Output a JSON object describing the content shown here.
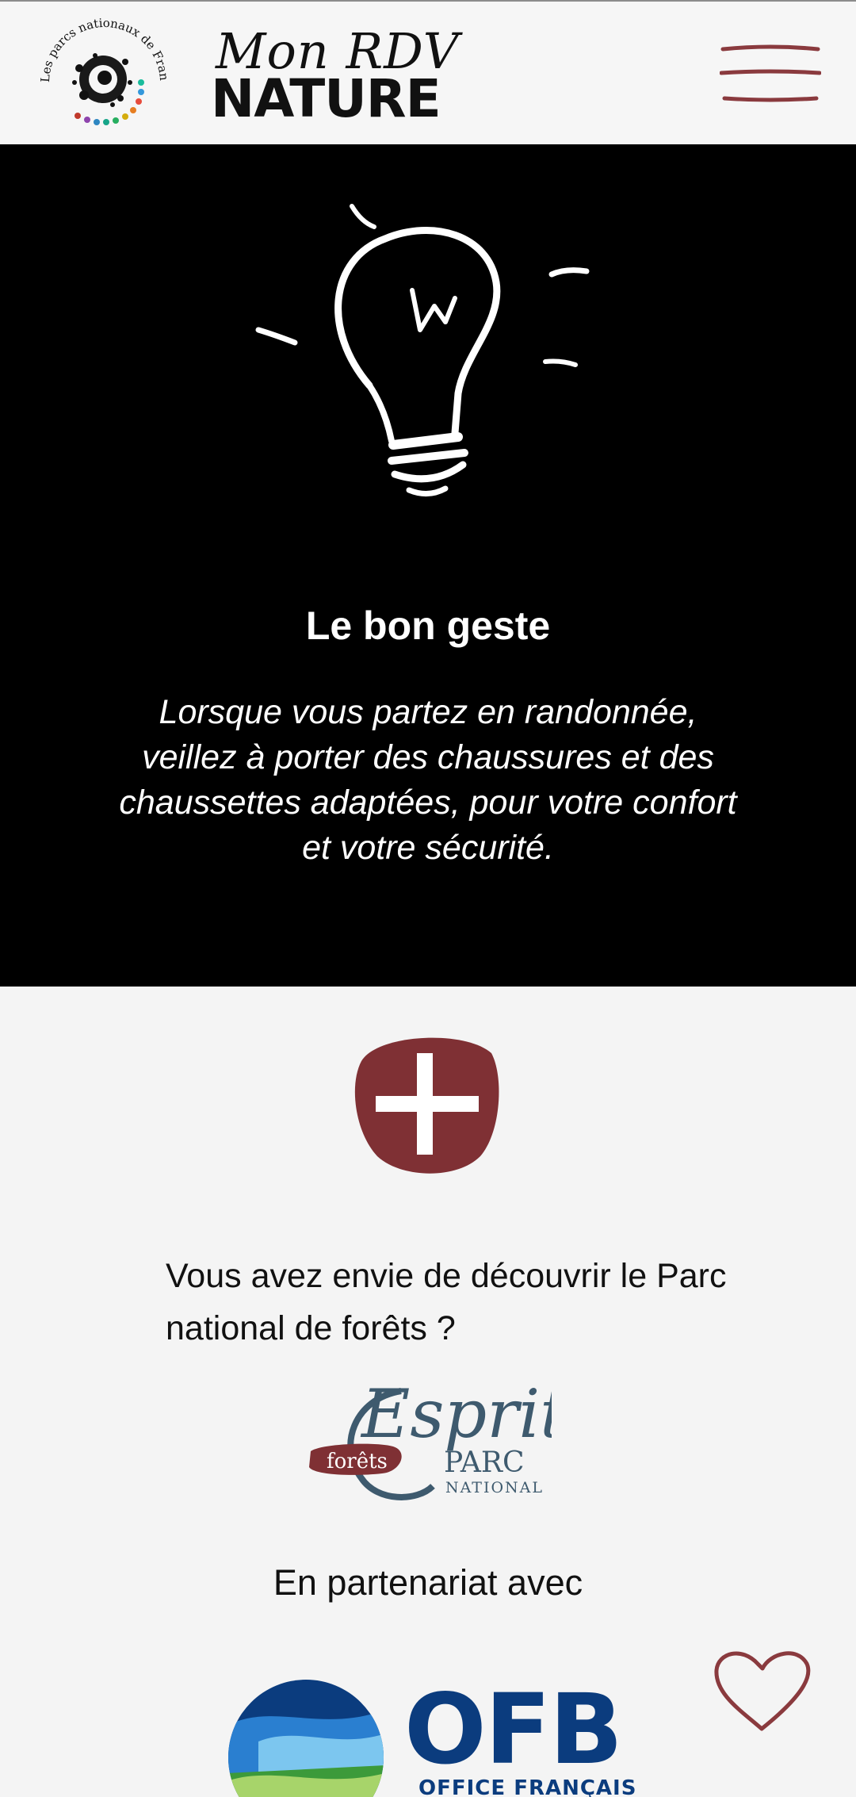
{
  "header": {
    "parks_logo_text": "Les parcs nationaux de France",
    "brand_script": "Mon RDV",
    "brand_bold": "NATURE",
    "menu_icon": "hamburger-menu-icon",
    "accent_color": "#8a3a3e"
  },
  "hero": {
    "icon": "lightbulb-icon",
    "title": "Le bon geste",
    "text": "Lorsque vous partez en randonnée, veillez à porter des chaussures et des chaussettes adaptées, pour votre confort et votre sécurité."
  },
  "more": {
    "icon": "plus-icon",
    "color": "#7f3034"
  },
  "discover": {
    "text": "Vous avez envie de découvrir le Parc national de forêts ?"
  },
  "esprit_logo": {
    "script": "Esprit",
    "badge": "forêts",
    "line1": "PARC",
    "line2": "NATIONAL"
  },
  "partners": {
    "label": "En partenariat avec",
    "ofb_big": "OFB",
    "ofb_small": "OFFICE FRANÇAIS"
  },
  "favorite": {
    "icon": "heart-outline-icon"
  }
}
